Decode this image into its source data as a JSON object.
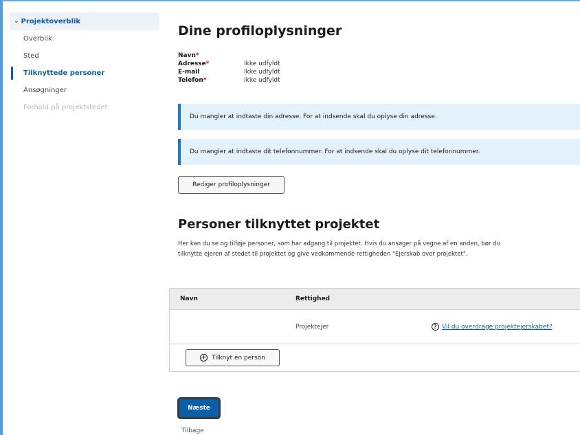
{
  "sidebar": {
    "header": "Projektoverblik",
    "items": [
      {
        "label": "Overblik"
      },
      {
        "label": "Sted"
      },
      {
        "label": "Tilknyttede personer"
      },
      {
        "label": "Ansøgninger"
      },
      {
        "label": "Forhold på projektstedet"
      }
    ]
  },
  "profile": {
    "title": "Dine profiloplysninger",
    "fields": [
      {
        "label": "Navn",
        "required": "*",
        "value": ""
      },
      {
        "label": "Adresse",
        "required": "*",
        "value": "Ikke udfyldt"
      },
      {
        "label": "E-mail",
        "required": "",
        "value": "Ikke udfyldt"
      },
      {
        "label": "Telefon",
        "required": "*",
        "value": "Ikke udfyldt"
      }
    ],
    "alerts": [
      "Du mangler at indtaste din adresse. For at indsende skal du oplyse din adresse.",
      "Du mangler at indtaste dit telefonnummer. For at indsende skal du oplyse dit telefonnummer."
    ],
    "edit_button": "Rediger profiloplysninger"
  },
  "persons": {
    "title": "Personer tilknyttet projektet",
    "description": "Her kan du se og tilføje personer, som har adgang til projektet. Hvis du ansøger på vegne af en anden, bør du tilknytte ejeren af stedet til projektet og give vedkommende rettigheden \"Ejerskab over projektet\".",
    "columns": [
      "Navn",
      "Rettighed"
    ],
    "rows": [
      {
        "name": "",
        "right": "Projektejer",
        "link": "Vil du overdrage projektejerskabet?"
      }
    ],
    "add_button": "Tilknyt en person"
  },
  "footer": {
    "next_button": "Næste",
    "back_link": "Tilbage"
  },
  "colors": {
    "accent": "#0b5ea8",
    "alert_bg": "#e3f1fb",
    "required": "#c8102e"
  }
}
